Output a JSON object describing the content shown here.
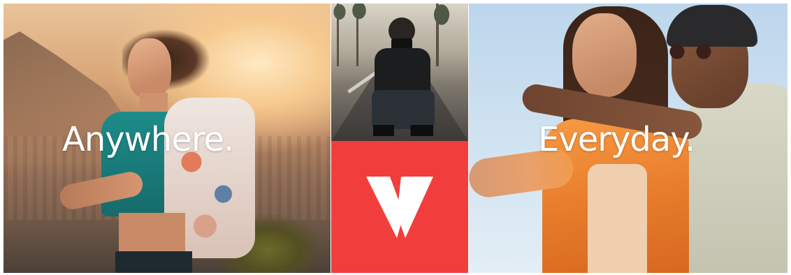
{
  "banner": {
    "left_panel": {
      "headline": "Anywhere."
    },
    "right_panel": {
      "headline": "Everyday."
    },
    "logo": {
      "icon": "v-logo-icon",
      "tile_color": "#f23d3d",
      "mark_color": "#ffffff"
    }
  },
  "colors": {
    "accent_red": "#f23d3d",
    "text_white": "#ffffff"
  }
}
